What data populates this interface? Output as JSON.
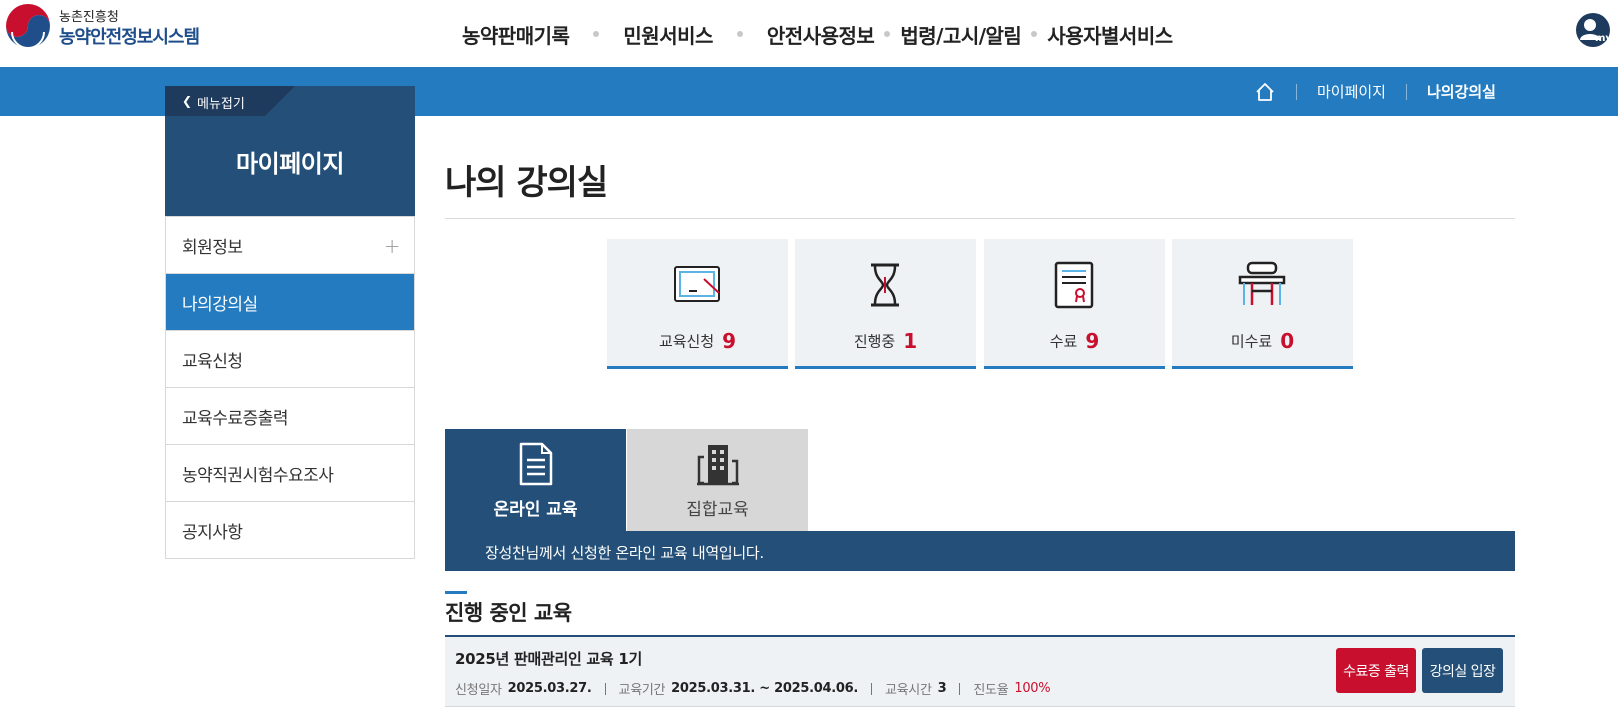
{
  "header": {
    "org_name": "농촌진흥청",
    "site_name": "농약안전정보시스템",
    "nav": [
      "농약판매기록",
      "민원서비스",
      "안전사용정보",
      "법령/고시/알림",
      "사용자별서비스"
    ],
    "my_label": "my"
  },
  "breadcrumb": {
    "items": [
      "마이페이지",
      "나의강의실"
    ]
  },
  "sidebar": {
    "toggle_label": "메뉴접기",
    "title": "마이페이지",
    "items": [
      {
        "label": "회원정보",
        "expandable": true
      },
      {
        "label": "나의강의실",
        "active": true
      },
      {
        "label": "교육신청"
      },
      {
        "label": "교육수료증출력"
      },
      {
        "label": "농약직권시험수요조사"
      },
      {
        "label": "공지사항"
      }
    ]
  },
  "main": {
    "title": "나의 강의실",
    "stats": [
      {
        "label": "교육신청",
        "value": "9",
        "icon": "monitor-icon"
      },
      {
        "label": "진행중",
        "value": "1",
        "icon": "hourglass-icon"
      },
      {
        "label": "수료",
        "value": "9",
        "icon": "certificate-icon"
      },
      {
        "label": "미수료",
        "value": "0",
        "icon": "desk-chair-icon"
      }
    ],
    "tabs": [
      {
        "label": "온라인 교육",
        "active": true,
        "icon": "document-icon"
      },
      {
        "label": "집합교육",
        "active": false,
        "icon": "building-icon"
      }
    ],
    "info_text": "장성찬님께서 신청한 온라인 교육 내역입니다.",
    "section_title": "진행 중인 교육",
    "course": {
      "title": "2025년 판매관리인 교육 1기",
      "apply_date_label": "신청일자",
      "apply_date": "2025.03.27.",
      "period_label": "교육기간",
      "period": "2025.03.31. ~ 2025.04.06.",
      "hours_label": "교육시간",
      "hours": "3",
      "progress_label": "진도율",
      "progress": "100%",
      "cert_button": "수료증 출력",
      "enter_button": "강의실 입장"
    }
  },
  "colors": {
    "primary_blue": "#247bc0",
    "navy": "#234f78",
    "accent_red": "#c8102e"
  }
}
